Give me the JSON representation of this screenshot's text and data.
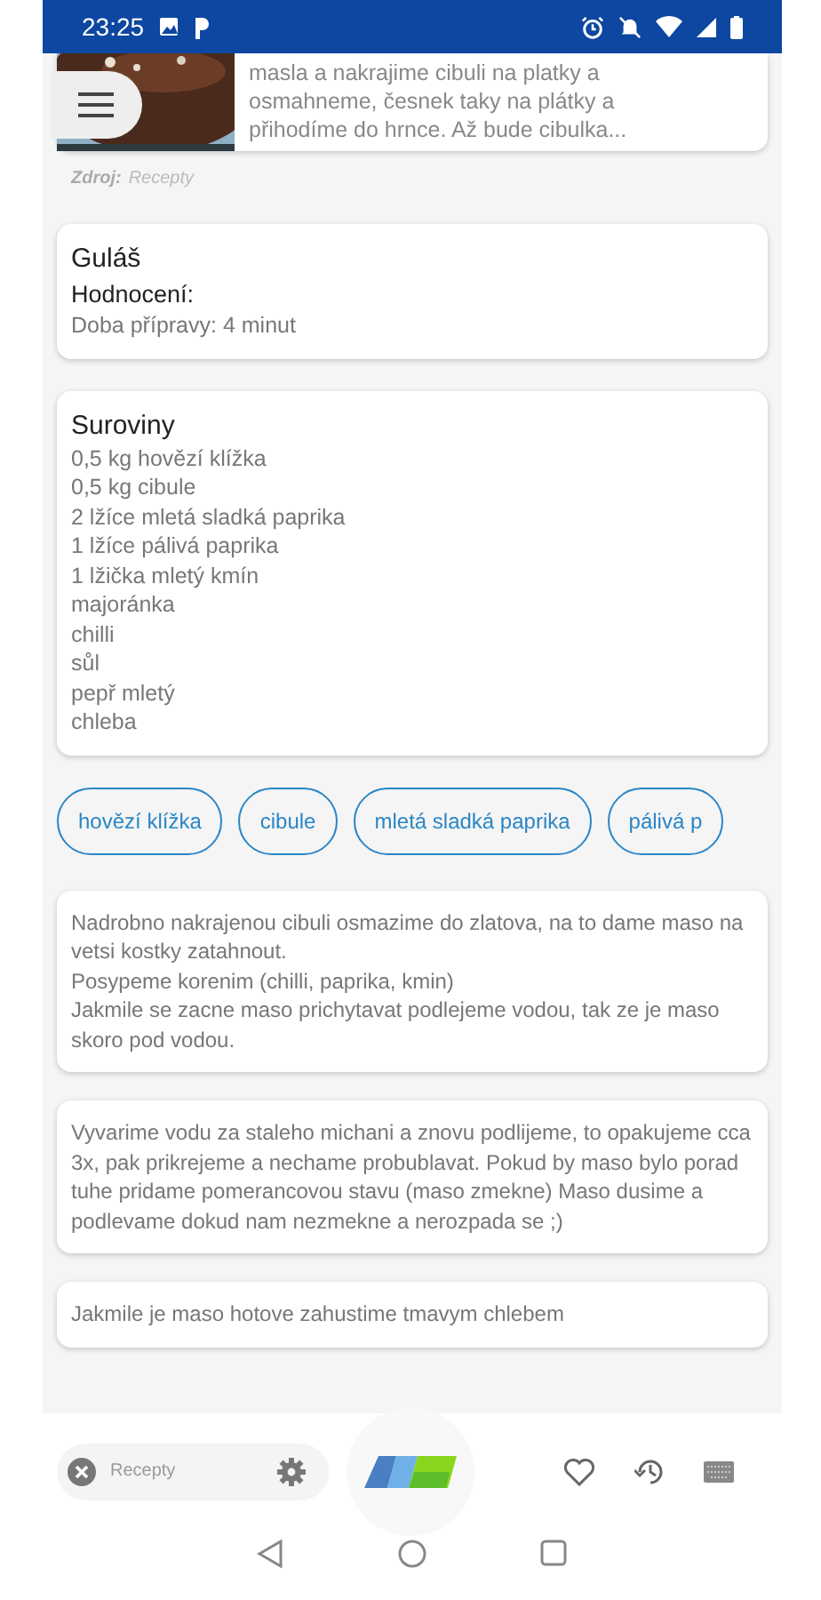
{
  "status_bar": {
    "time": "23:25"
  },
  "top_card": {
    "kind": "picture",
    "lines": [
      "masla a nakrajime cibuli na platky a",
      "osmahneme, česnek taky na plátky a",
      "přihodíme do hrnce. Až bude cibulka..."
    ]
  },
  "source": {
    "label": "Zdroj:",
    "value": "Recepty"
  },
  "recipe": {
    "title": "Guláš",
    "rating_label": "Hodnocení:",
    "prep_time": "Doba přípravy: 4 minut"
  },
  "ingredients": {
    "title": "Suroviny",
    "items": [
      "0,5 kg hovězí klížka",
      "0,5 kg cibule",
      "2 lžíce mletá sladká paprika",
      "1 lžíce pálivá paprika",
      "1 lžička mletý kmín",
      "majoránka",
      "chilli",
      "sůl",
      "pepř mletý",
      "chleba"
    ]
  },
  "chips": [
    "hovězí klížka",
    "cibule",
    "mletá sladká paprika",
    "pálivá p"
  ],
  "steps": [
    {
      "lines": [
        "Nadrobno nakrajenou cibuli osmazime do zlatova, na to dame maso na vetsi kostky zatahnout.",
        "Posypeme korenim (chilli, paprika, kmin)",
        "Jakmile se zacne maso prichytavat podlejeme vodou, tak ze je maso skoro pod vodou."
      ]
    },
    {
      "lines": [
        "Vyvarime vodu za staleho michani a znovu podlijeme,  to opakujeme cca 3x, pak prikrejeme a nechame probublavat. Pokud by maso bylo porad tuhe pridame pomerancovou stavu (maso zmekne) Maso dusime a podlevame dokud nam nezmekne a nerozpada se ;)"
      ]
    },
    {
      "lines": [
        "Jakmile je maso hotove zahustime tmavym chlebem"
      ]
    }
  ],
  "bottom_bar": {
    "search": {
      "value": "Recepty"
    }
  }
}
